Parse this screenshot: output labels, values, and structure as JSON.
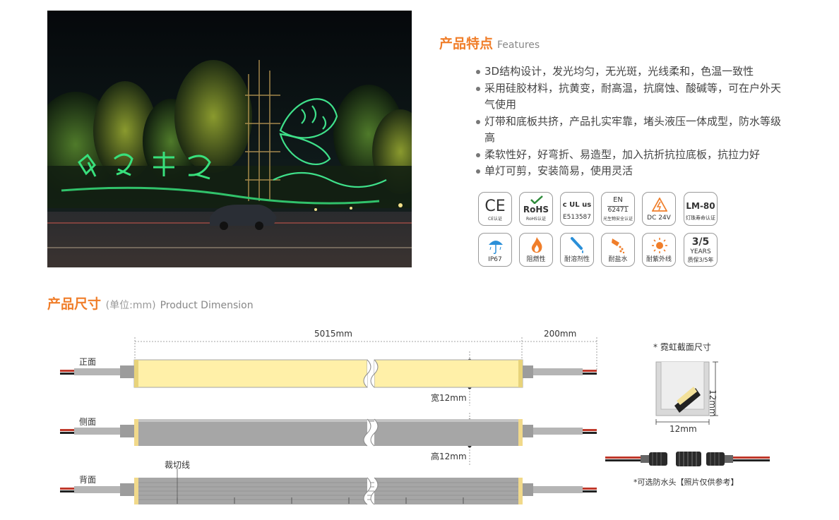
{
  "features": {
    "title": "产品特点",
    "title_en": "Features",
    "items": [
      "3D结构设计，发光均匀，无光斑，光线柔和，色温一致性",
      "采用硅胶材料，抗黄变，耐高温，抗腐蚀、酸碱等，可在户外天气使用",
      "灯带和底板共挤，产品扎实牢靠，堵头液压一体成型，防水等级高",
      "柔软性好，好弯折、易造型，加入抗折抗拉底板，抗拉力好",
      "单灯可剪，安装简易，使用灵活"
    ]
  },
  "badges": {
    "row1": [
      {
        "icon": "ce-mark-icon",
        "main": "CE",
        "label": "CE认证"
      },
      {
        "icon": "rohs-check-icon",
        "main": "RoHS",
        "label": "RoHS认证"
      },
      {
        "icon": "ul-mark-icon",
        "main": "c UL us",
        "label": "E513587"
      },
      {
        "icon": "en-standard-icon",
        "main": "EN",
        "sub": "62471",
        "label": "光生物安全认证"
      },
      {
        "icon": "dc-warning-icon",
        "main": "",
        "label": "DC 24V"
      },
      {
        "icon": "lm80-icon",
        "main": "LM-80",
        "label": "灯珠寿命认证"
      }
    ],
    "row2": [
      {
        "icon": "umbrella-rain-icon",
        "label": "IP67"
      },
      {
        "icon": "flame-icon",
        "label": "阻燃性"
      },
      {
        "icon": "dropper-icon",
        "label": "耐溶剂性"
      },
      {
        "icon": "salt-pour-icon",
        "label": "耐盐水"
      },
      {
        "icon": "sun-icon",
        "label": "耐紫外线"
      },
      {
        "icon": "warranty-icon",
        "main": "3/5",
        "sub": "YEARS",
        "label": "质保3/5年"
      }
    ]
  },
  "dimension": {
    "title": "产品尺寸",
    "unit": "(单位:mm)",
    "title_en": "Product Dimension",
    "length_label": "5015mm",
    "lead_label": "200mm",
    "width_label": "宽12mm",
    "height_label": "高12mm",
    "views": {
      "front": "正面",
      "side": "侧面",
      "back": "背面"
    },
    "cut_line": "裁切线",
    "section_title": "* 霓虹截面尺寸",
    "section_w": "12mm",
    "section_h": "12mm",
    "connector_note": "*可选防水头【照片仅供参考】"
  },
  "colors": {
    "accent": "#f07e2a",
    "led": "#fff3b8",
    "profile_gray": "#a6a6a6"
  }
}
